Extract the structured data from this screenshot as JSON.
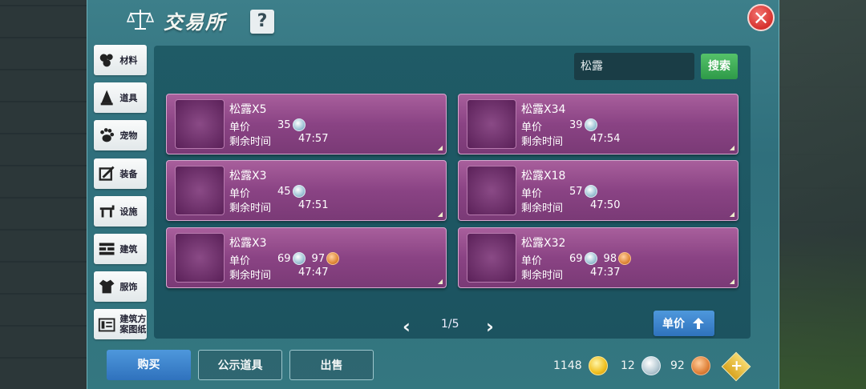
{
  "header": {
    "title": "交易所",
    "help_label": "?",
    "close_label": "✕"
  },
  "sidebar": {
    "items": [
      {
        "label": "材料",
        "icon": "materials-icon"
      },
      {
        "label": "道具",
        "icon": "item-icon"
      },
      {
        "label": "宠物",
        "icon": "pet-paw-icon"
      },
      {
        "label": "装备",
        "icon": "equipment-icon"
      },
      {
        "label": "设施",
        "icon": "facility-icon"
      },
      {
        "label": "建筑",
        "icon": "building-icon"
      },
      {
        "label": "服饰",
        "icon": "clothing-icon"
      },
      {
        "label": "建筑方案图纸",
        "icon": "blueprint-icon"
      }
    ]
  },
  "search": {
    "value": "松露",
    "button_label": "搜索"
  },
  "listings": {
    "price_label": "单价",
    "time_label": "剩余时间",
    "items": [
      {
        "name": "松露X5",
        "silver": "35",
        "copper": "",
        "time": "47:57"
      },
      {
        "name": "松露X34",
        "silver": "39",
        "copper": "",
        "time": "47:54"
      },
      {
        "name": "松露X3",
        "silver": "45",
        "copper": "",
        "time": "47:51"
      },
      {
        "name": "松露X18",
        "silver": "57",
        "copper": "",
        "time": "47:50"
      },
      {
        "name": "松露X3",
        "silver": "69",
        "copper": "97",
        "time": "47:47"
      },
      {
        "name": "松露X32",
        "silver": "69",
        "copper": "98",
        "time": "47:37"
      }
    ]
  },
  "pager": {
    "text": "1/5",
    "prev": "‹",
    "next": "›"
  },
  "sort": {
    "label": "单价"
  },
  "bottom": {
    "buy": "购买",
    "public": "公示道具",
    "sell": "出售"
  },
  "currency": {
    "gold": "1148",
    "silver": "12",
    "copper": "92",
    "add_label": "+"
  },
  "colors": {
    "panel": "#2f6f7c",
    "card": "#8a4384",
    "accent_blue": "#2f72bd",
    "search_green": "#2e9a48",
    "close_red": "#d6302c"
  }
}
